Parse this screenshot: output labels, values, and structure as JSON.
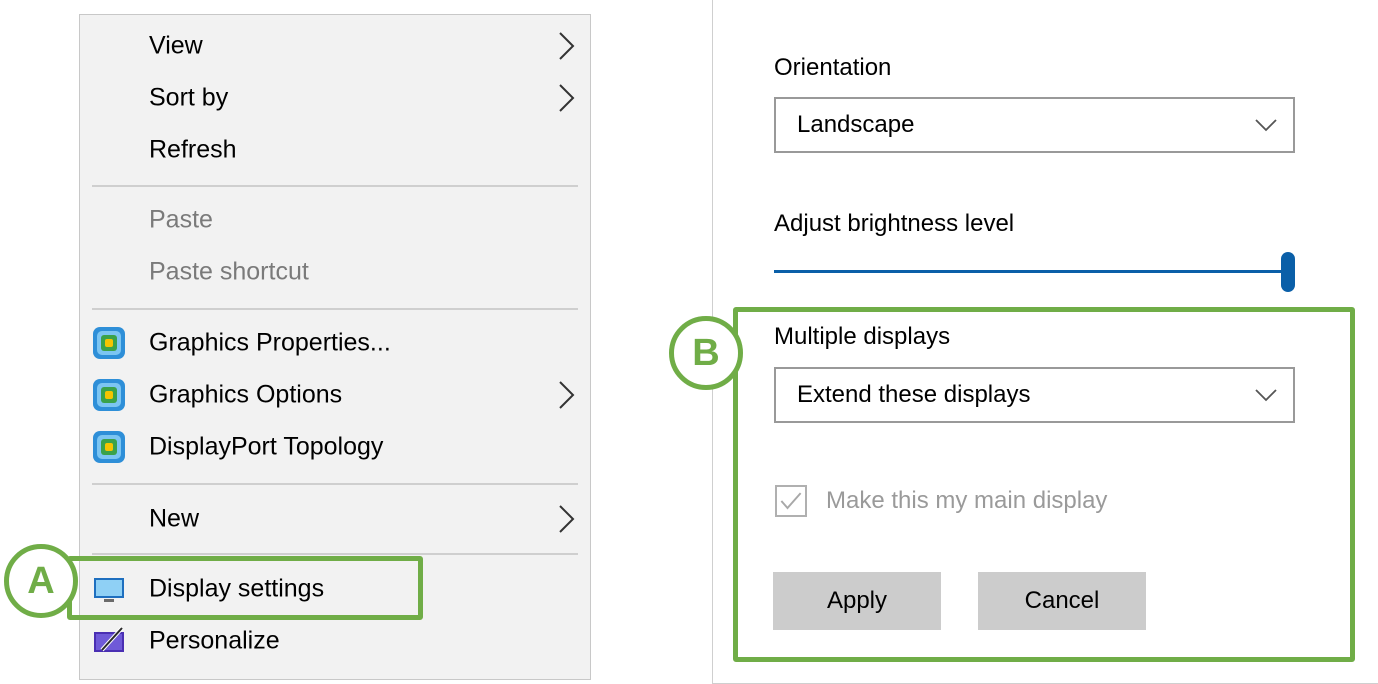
{
  "context_menu": {
    "items": [
      {
        "label": "View",
        "submenu": true,
        "disabled": false
      },
      {
        "label": "Sort by",
        "submenu": true,
        "disabled": false
      },
      {
        "label": "Refresh",
        "submenu": false,
        "disabled": false
      },
      {
        "label": "Paste",
        "submenu": false,
        "disabled": true
      },
      {
        "label": "Paste shortcut",
        "submenu": false,
        "disabled": true
      },
      {
        "label": "Graphics Properties...",
        "icon": "intel-graphics-icon",
        "submenu": false,
        "disabled": false
      },
      {
        "label": "Graphics Options",
        "icon": "intel-graphics-icon",
        "submenu": true,
        "disabled": false
      },
      {
        "label": "DisplayPort Topology",
        "icon": "intel-graphics-icon",
        "submenu": false,
        "disabled": false
      },
      {
        "label": "New",
        "submenu": true,
        "disabled": false
      },
      {
        "label": "Display settings",
        "icon": "monitor-icon",
        "submenu": false,
        "disabled": false
      },
      {
        "label": "Personalize",
        "icon": "personalize-icon",
        "submenu": false,
        "disabled": false
      }
    ]
  },
  "settings": {
    "orientation": {
      "label": "Orientation",
      "value": "Landscape"
    },
    "brightness": {
      "label": "Adjust brightness level",
      "level": 1.0
    },
    "multiple_displays": {
      "label": "Multiple displays",
      "value": "Extend these displays"
    },
    "main_display": {
      "label": "Make this my main display",
      "checked": true,
      "disabled": true
    },
    "buttons": {
      "apply": "Apply",
      "cancel": "Cancel"
    }
  },
  "annotations": {
    "a": "A",
    "b": "B",
    "color": "#70ad47"
  },
  "colors": {
    "accent": "#0a5fa8",
    "annotation": "#70ad47",
    "menu_bg": "#f2f2f2",
    "disabled_text": "#7a7a7a"
  }
}
